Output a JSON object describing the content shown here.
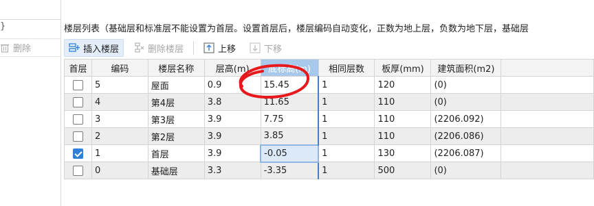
{
  "left_panel": {
    "stub_text": "}",
    "delete_label": "删除"
  },
  "hint_text": "楼层列表（基础层和标准层不能设置为首层。设置首层后，楼层编码自动变化，正数为地上层，负数为地下层，基础层",
  "toolbar": {
    "insert_label": "插入楼层",
    "delete_label": "删除楼层",
    "up_label": "上移",
    "down_label": "下移"
  },
  "table": {
    "headers": [
      "首层",
      "编码",
      "楼层名称",
      "层高(m)",
      "底标高(m)",
      "相同层数",
      "板厚(mm)",
      "建筑面积(m2)"
    ],
    "rows": [
      {
        "first": false,
        "code": "5",
        "name": "屋面",
        "height": "0.9",
        "elev": "15.45",
        "same": "1",
        "thick": "120",
        "area": "(0)"
      },
      {
        "first": false,
        "code": "4",
        "name": "第4层",
        "height": "3.8",
        "elev": "11.65",
        "same": "1",
        "thick": "110",
        "area": "(0)"
      },
      {
        "first": false,
        "code": "3",
        "name": "第3层",
        "height": "3.9",
        "elev": "7.75",
        "same": "1",
        "thick": "110",
        "area": "(2206.092)"
      },
      {
        "first": false,
        "code": "2",
        "name": "第2层",
        "height": "3.9",
        "elev": "3.85",
        "same": "1",
        "thick": "110",
        "area": "(2206.086)"
      },
      {
        "first": true,
        "code": "1",
        "name": "首层",
        "height": "3.9",
        "elev": "-0.05",
        "same": "1",
        "thick": "130",
        "area": "(2206.087)"
      },
      {
        "first": false,
        "code": "0",
        "name": "基础层",
        "height": "3.3",
        "elev": "-3.35",
        "same": "1",
        "thick": "500",
        "area": "(0)"
      }
    ]
  },
  "colors": {
    "accent": "#2f80d6",
    "header_highlight": "#a9c9ec",
    "annotation": "#e8191d"
  }
}
